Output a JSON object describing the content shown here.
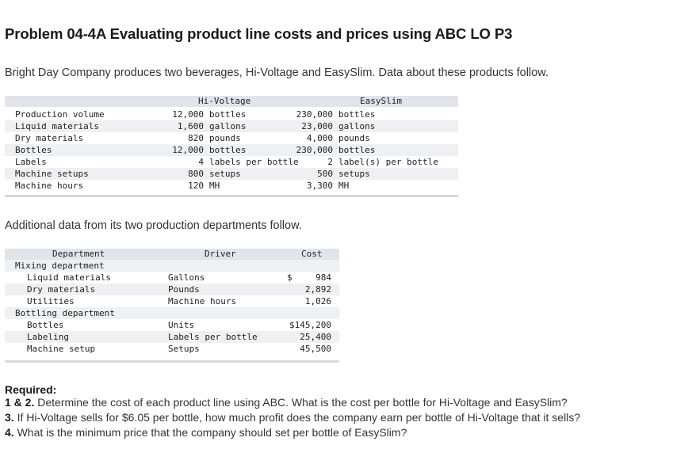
{
  "title": "Problem 04-4A Evaluating product line costs and prices using ABC LO P3",
  "intro": "Bright Day Company produces two beverages, Hi-Voltage and EasySlim. Data about these products follow.",
  "product_table": {
    "headers": [
      "Hi-Voltage",
      "EasySlim"
    ],
    "rows": [
      {
        "label": "Production volume",
        "hv": "12,000 bottles",
        "es": "230,000 bottles"
      },
      {
        "label": "Liquid materials",
        "hv": "1,600 gallons",
        "es": "23,000 gallons"
      },
      {
        "label": "Dry materials",
        "hv": "820 pounds",
        "es": "4,000 pounds"
      },
      {
        "label": "Bottles",
        "hv": "12,000 bottles",
        "es": "230,000 bottles"
      },
      {
        "label": "Labels",
        "hv": "4 labels per bottle",
        "es": "2 label(s) per bottle"
      },
      {
        "label": "Machine setups",
        "hv": "800 setups",
        "es": "500 setups"
      },
      {
        "label": "Machine hours",
        "hv": "120 MH",
        "es": "3,300 MH"
      }
    ]
  },
  "additional_text": "Additional data from its two production departments follow.",
  "dept_table": {
    "headers": [
      "Department",
      "Driver",
      "Cost"
    ],
    "rows": [
      {
        "dept": "Mixing department",
        "driver": "",
        "cost": "",
        "indent": false
      },
      {
        "dept": "Liquid materials",
        "driver": "Gallons",
        "cost": "984",
        "dollar": "$",
        "indent": true
      },
      {
        "dept": "Dry materials",
        "driver": "Pounds",
        "cost": "2,892",
        "indent": true
      },
      {
        "dept": "Utilities",
        "driver": "Machine hours",
        "cost": "1,026",
        "indent": true
      },
      {
        "dept": "Bottling department",
        "driver": "",
        "cost": "",
        "indent": false
      },
      {
        "dept": "Bottles",
        "driver": "Units",
        "cost": "$145,200",
        "indent": true
      },
      {
        "dept": "Labeling",
        "driver": "Labels per bottle",
        "cost": "25,400",
        "indent": true
      },
      {
        "dept": "Machine setup",
        "driver": "Setups",
        "cost": "45,500",
        "indent": true
      }
    ]
  },
  "required": {
    "heading": "Required:",
    "items": [
      {
        "num": "1 & 2.",
        "text": " Determine the cost of each product line using ABC. What is the cost per bottle for Hi-Voltage and EasySlim?"
      },
      {
        "num": "3.",
        "text": " If Hi-Voltage sells for $6.05 per bottle, how much profit does the company earn per bottle of Hi-Voltage that it sells?"
      },
      {
        "num": "4.",
        "text": " What is the minimum price that the company should set per bottle of EasySlim?"
      }
    ]
  }
}
